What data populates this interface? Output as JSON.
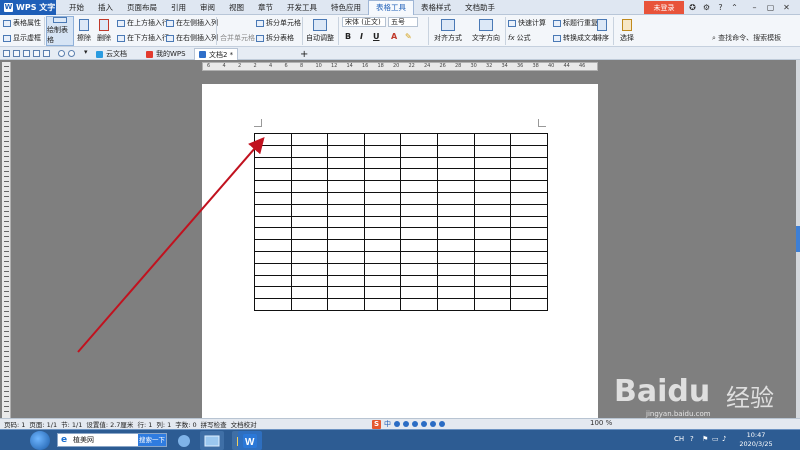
{
  "app": {
    "title": "WPS 文字",
    "login_label": "未登录",
    "icon_letter": "W"
  },
  "menu": [
    "开始",
    "插入",
    "页面布局",
    "引用",
    "审阅",
    "视图",
    "章节",
    "开发工具",
    "特色应用",
    "表格工具",
    "表格样式",
    "文档助手"
  ],
  "menu_active_index": 9,
  "ribbon": {
    "table_props": "表格属性",
    "show_gridlines": "显示虚框",
    "draw_table": "绘制表格",
    "erase": "擦除",
    "delete": "删除",
    "insert_above": "在上方插入行",
    "insert_below": "在下方插入行",
    "insert_left": "在左侧插入列",
    "insert_right": "在右侧插入列",
    "merge_cells": "合并单元格",
    "split_cells": "拆分单元格",
    "split_table": "拆分表格",
    "autofit": "自动调整",
    "font_name": "宋体 (正文)",
    "font_size": "五号",
    "bold": "B",
    "italic": "I",
    "underline": "U",
    "font_color": "A",
    "align": "对齐方式",
    "text_direction": "文字方向",
    "quick_calc": "快速计算",
    "formula": "公式",
    "repeat_header": "标题行重复",
    "convert_to_text": "转换成文本",
    "sort": "排序",
    "select": "选择",
    "search_commands": "查找命令、搜索模板"
  },
  "doc_tabs": [
    {
      "label": "云文档",
      "color": "#2a9be0"
    },
    {
      "label": "我的WPS",
      "color": "#e23a2e"
    },
    {
      "label": "文档2 *",
      "color": "#2f6fc9"
    }
  ],
  "doc_tab_active_index": 2,
  "new_tab_label": "+",
  "ruler_numbers": [
    "6",
    "4",
    "2",
    "2",
    "4",
    "6",
    "8",
    "10",
    "12",
    "14",
    "16",
    "18",
    "20",
    "22",
    "24",
    "26",
    "28",
    "30",
    "32",
    "34",
    "36",
    "38",
    "40",
    "44",
    "46"
  ],
  "table": {
    "rows": 15,
    "cols": 8
  },
  "status": {
    "page_num": "页码: 1",
    "pages": "页面: 1/1",
    "section": "节: 1/1",
    "setting": "设置值: 2.7厘米",
    "row": "行: 1",
    "col": "列: 1",
    "words": "字数: 0",
    "spellcheck": "拼写检查",
    "doc_proof": "文档校对",
    "zoom": "100 %"
  },
  "ime": {
    "logo": "S",
    "mode": "中"
  },
  "taskbar": {
    "search_value": "植美网",
    "search_button": "搜索一下",
    "clock_time": "10:47",
    "clock_date": "2020/3/25",
    "lang": "CH"
  },
  "watermark": {
    "brand": "Baidu",
    "cn": "经验",
    "url": "jingyan.baidu.com"
  },
  "colors": {
    "accent": "#1f5fb8",
    "login": "#e8533a",
    "arrow": "#c1121f",
    "taskbar": "#2d5c93"
  }
}
